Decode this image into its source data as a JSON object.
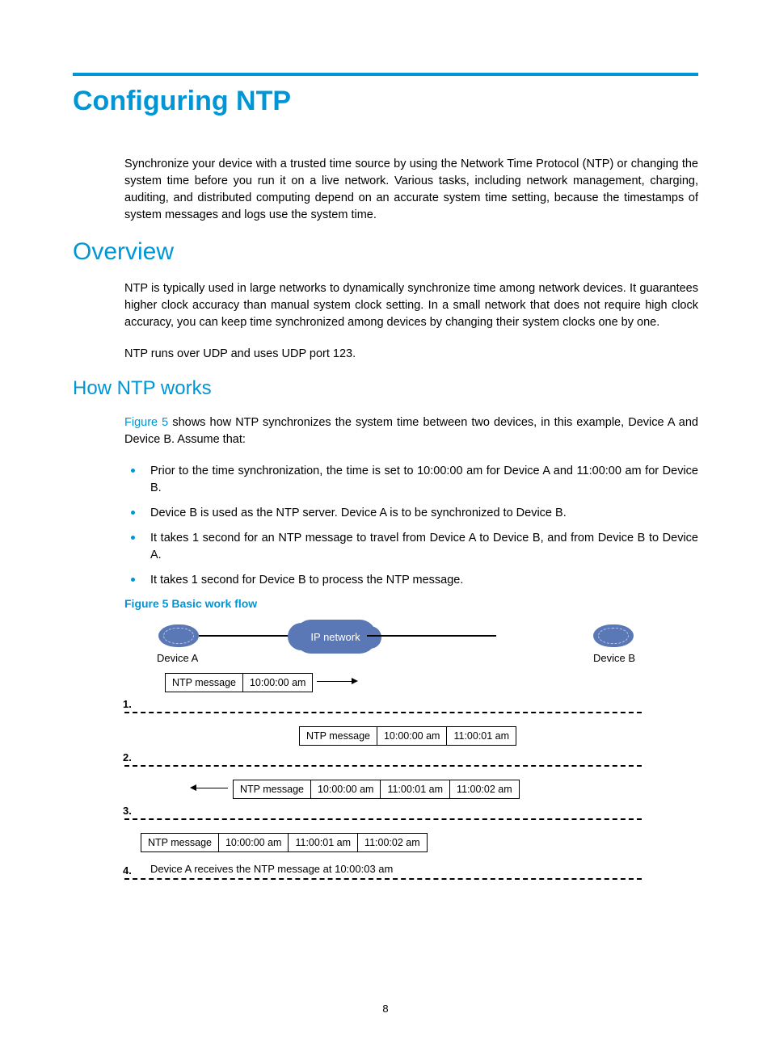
{
  "title": "Configuring NTP",
  "intro": "Synchronize your device with a trusted time source by using the Network Time Protocol (NTP) or changing the system time before you run it on a live network. Various tasks, including network management, charging, auditing, and distributed computing depend on an accurate system time setting, because the timestamps of system messages and logs use the system time.",
  "overview_heading": "Overview",
  "overview_p1": "NTP is typically used in large networks to dynamically synchronize time among network devices. It guarantees higher clock accuracy than manual system clock setting. In a small network that does not require high clock accuracy, you can keep time synchronized among devices by changing their system clocks one by one.",
  "overview_p2": "NTP runs over UDP and uses UDP port 123.",
  "how_heading": "How NTP works",
  "fig_ref": "Figure 5",
  "how_intro_rest": " shows how NTP synchronizes the system time between two devices, in this example, Device A and Device B. Assume that:",
  "bullets": [
    "Prior to the time synchronization, the time is set to 10:00:00 am for Device A and 11:00:00 am for Device B.",
    "Device B is used as the NTP server. Device A is to be synchronized to Device B.",
    "It takes 1 second for an NTP message to travel from Device A to Device B, and from Device B to Device A.",
    "It takes 1 second for Device B to process the NTP message."
  ],
  "figure_caption": "Figure 5 Basic work flow",
  "diagram": {
    "cloud": "IP network",
    "device_a": "Device A",
    "device_b": "Device B",
    "rows": [
      {
        "num": "1.",
        "cells": [
          "NTP message",
          "10:00:00 am"
        ]
      },
      {
        "num": "2.",
        "cells": [
          "NTP message",
          "10:00:00 am",
          "11:00:01 am"
        ]
      },
      {
        "num": "3.",
        "cells": [
          "NTP message",
          "10:00:00 am",
          "11:00:01 am",
          "11:00:02 am"
        ]
      },
      {
        "num": "4.",
        "cells": [
          "NTP message",
          "10:00:00 am",
          "11:00:01 am",
          "11:00:02 am"
        ],
        "note": "Device A receives the NTP message at 10:00:03 am"
      }
    ]
  },
  "page_number": "8"
}
